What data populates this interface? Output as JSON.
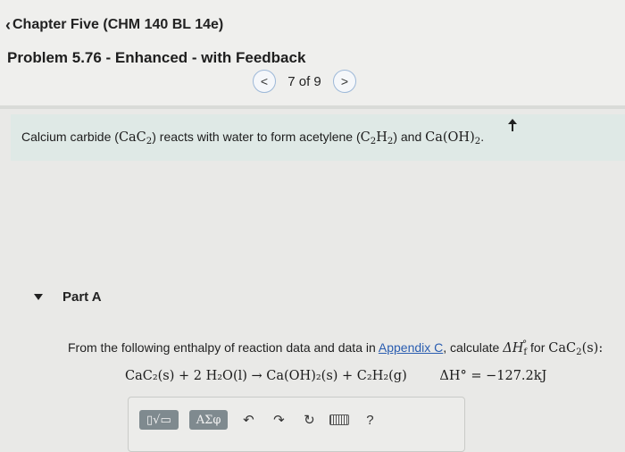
{
  "header": {
    "back_link_label": "Chapter Five (CHM 140 BL 14e)",
    "problem_title": "Problem 5.76 - Enhanced - with Feedback",
    "pager": {
      "text": "7 of 9"
    }
  },
  "intro": {
    "text_1": "Calcium carbide (",
    "formula_1": "CaC",
    "formula_1_sub": "2",
    "text_2": ") reacts with water to form acetylene (",
    "formula_2a": "C",
    "formula_2a_sub": "2",
    "formula_2b": "H",
    "formula_2b_sub": "2",
    "text_3": ") and ",
    "formula_3": "Ca(OH)",
    "formula_3_sub": "2",
    "text_4": "."
  },
  "part": {
    "label": "Part A"
  },
  "question": {
    "text_1": "From the following enthalpy of reaction data and data in ",
    "link": "Appendix C",
    "text_2": ", calculate ",
    "symbol": "ΔH",
    "symbol_sub": "f",
    "symbol_sup": "°",
    "text_3": " for ",
    "species": "CaC",
    "species_sub": "2",
    "species_state": "(s):"
  },
  "equation": {
    "reaction": "CaC₂(s) + 2 H₂O(l) → Ca(OH)₂(s) + C₂H₂(g)",
    "enthalpy": "ΔH° = −127.2kJ"
  },
  "toolbar": {
    "templates_label": "▯√▭",
    "greek_label": "ΑΣφ",
    "undo_icon": "undo-icon",
    "redo_icon": "redo-icon",
    "reset_icon": "reset-icon",
    "keyboard_icon": "keyboard-icon",
    "help_label": "?"
  }
}
